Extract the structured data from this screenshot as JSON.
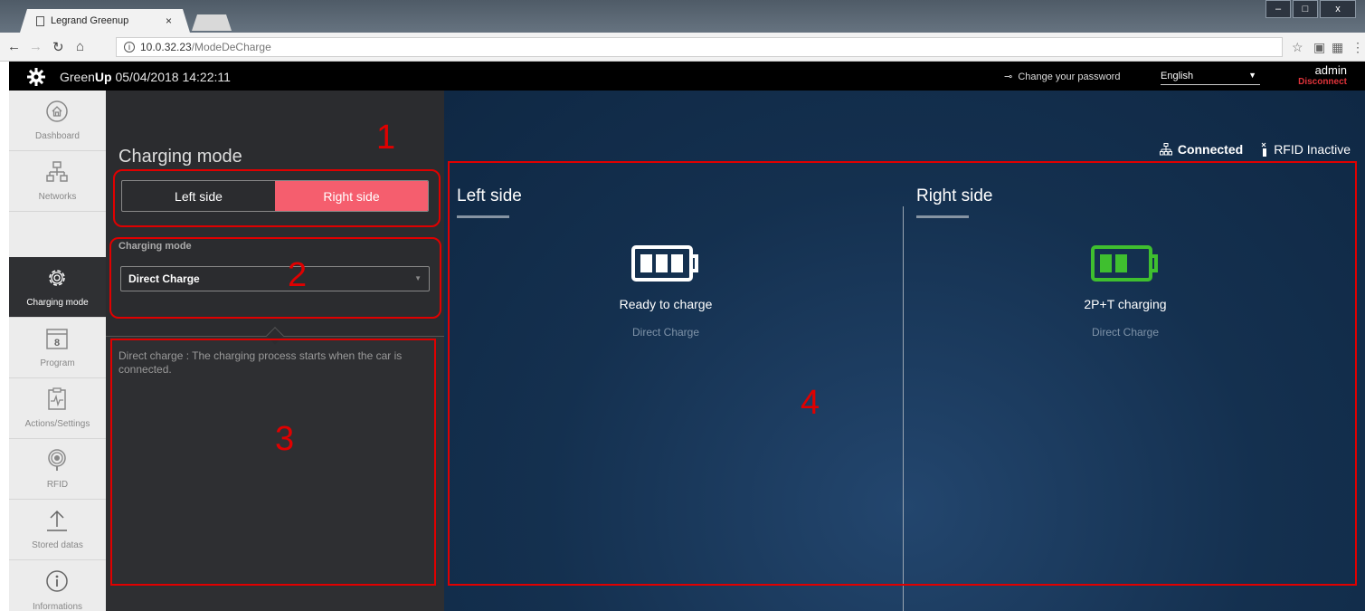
{
  "browser": {
    "tab_title": "Legrand Greenup",
    "tab_close": "×",
    "url_host": "10.0.32.23",
    "url_path": "/ModeDeCharge",
    "window_min": "–",
    "window_max": "□",
    "window_close": "x"
  },
  "header": {
    "brand_light": "Green",
    "brand_bold": "Up",
    "datetime": "05/04/2018 14:22:11",
    "change_password": "Change your password",
    "language": "English",
    "user": "admin",
    "disconnect": "Disconnect"
  },
  "sidebar": {
    "items": [
      {
        "label": "Dashboard",
        "icon": "home-icon"
      },
      {
        "label": "Networks",
        "icon": "network-icon"
      },
      {
        "label": "Charging mode",
        "icon": "gear-icon",
        "active": true
      },
      {
        "label": "Program",
        "icon": "calendar-icon",
        "calendar_number": "8"
      },
      {
        "label": "Actions/Settings",
        "icon": "clipboard-pulse-icon"
      },
      {
        "label": "RFID",
        "icon": "rfid-icon"
      },
      {
        "label": "Stored datas",
        "icon": "upload-icon"
      },
      {
        "label": "Informations",
        "icon": "info-icon"
      }
    ]
  },
  "panel": {
    "title": "Charging mode",
    "toggle": {
      "left": "Left side",
      "right": "Right side",
      "selected": "right"
    },
    "field_label": "Charging mode",
    "select_value": "Direct Charge",
    "description": "Direct charge : The charging process starts when the car is connected."
  },
  "main": {
    "connection_status": "Connected",
    "rfid_status": "RFID Inactive",
    "left": {
      "title": "Left side",
      "state": "Ready to charge",
      "mode": "Direct Charge",
      "battery_color": "#ffffff",
      "battery_bars": 3
    },
    "right": {
      "title": "Right side",
      "state": "2P+T charging",
      "mode": "Direct Charge",
      "battery_color": "#3fbf2f",
      "battery_bars": 2
    }
  },
  "annotations": [
    "1",
    "2",
    "3",
    "4"
  ],
  "colors": {
    "accent": "#f55e6e",
    "annotation": "#e00000",
    "charging": "#3fbf2f"
  }
}
